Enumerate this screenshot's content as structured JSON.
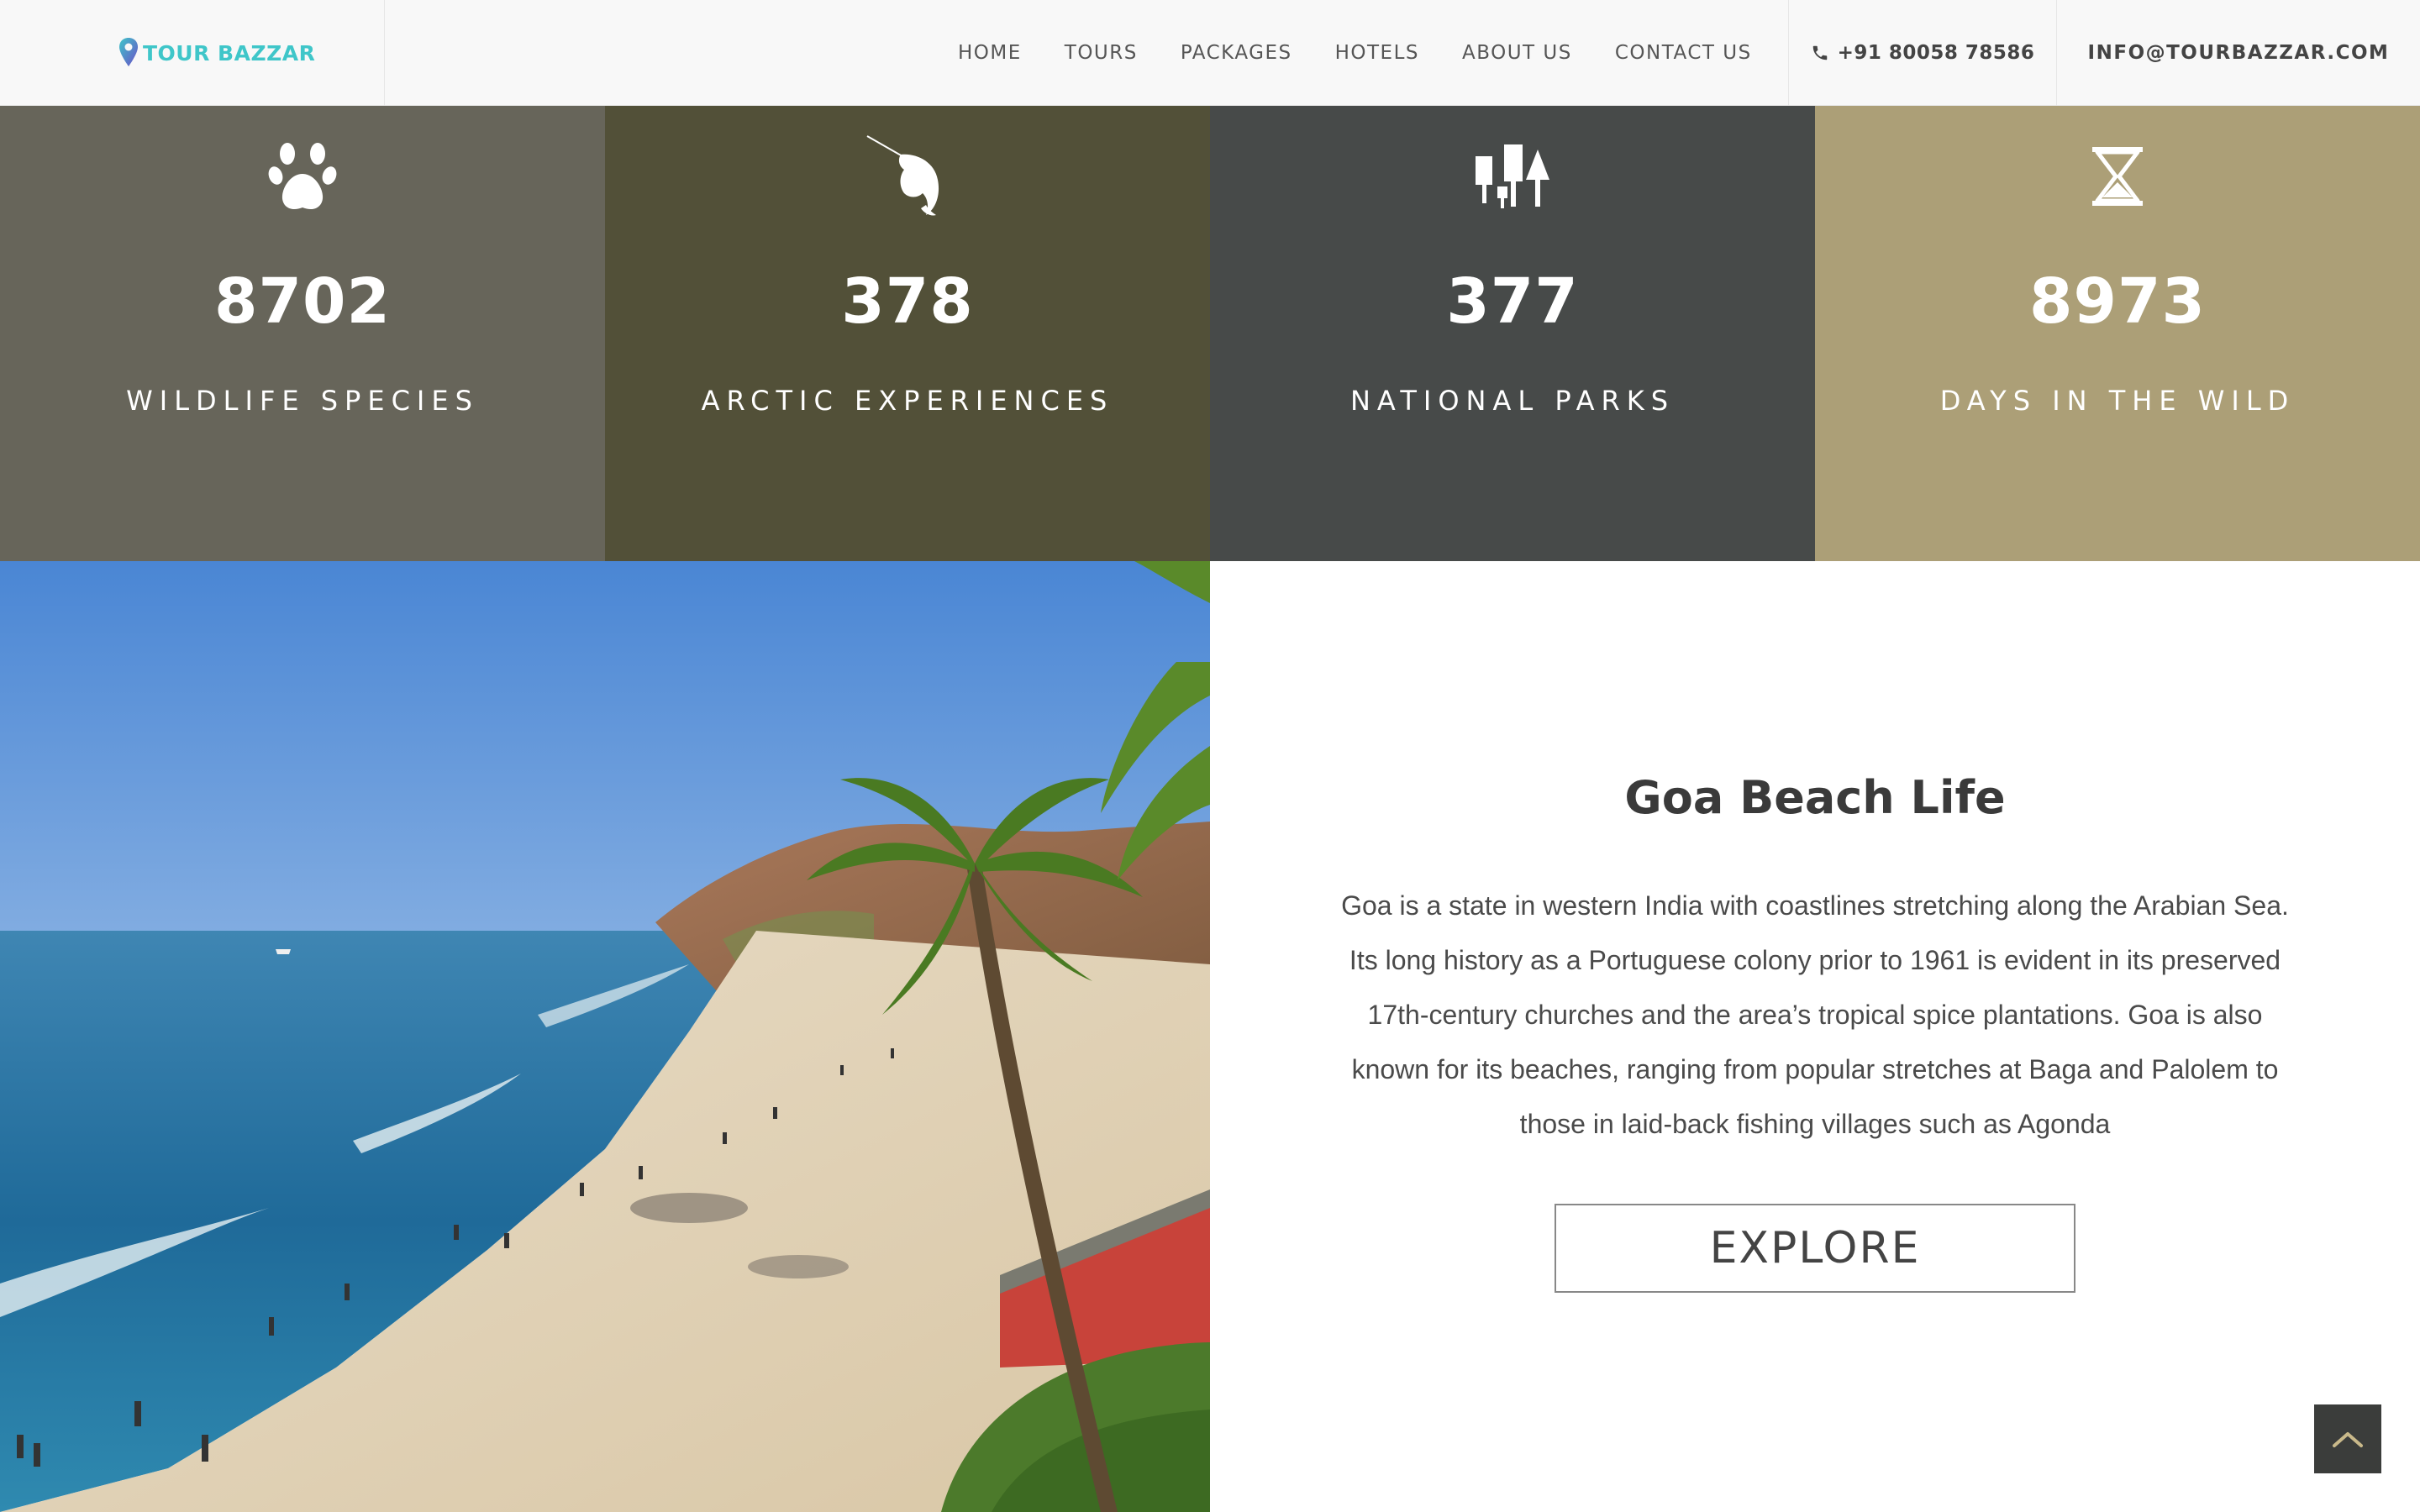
{
  "brand": {
    "name": "TOUR BAZZAR",
    "logo_icon": "map-pin-icon",
    "color": "#3fc6c9"
  },
  "nav": {
    "items": [
      {
        "label": "HOME"
      },
      {
        "label": "TOURS"
      },
      {
        "label": "PACKAGES"
      },
      {
        "label": "HOTELS"
      },
      {
        "label": "ABOUT US"
      },
      {
        "label": "CONTACT US"
      }
    ]
  },
  "contact": {
    "phone_icon": "phone-icon",
    "phone": "+91 80058 78586",
    "email": "INFO@TOURBAZZAR.COM"
  },
  "stats": [
    {
      "icon": "paw-icon",
      "value": "8702",
      "label": "WILDLIFE SPECIES",
      "bg": "#67655a"
    },
    {
      "icon": "narwhal-icon",
      "value": "378",
      "label": "ARCTIC EXPERIENCES",
      "bg": "#525038"
    },
    {
      "icon": "trees-icon",
      "value": "377",
      "label": "NATIONAL PARKS",
      "bg": "#474a49"
    },
    {
      "icon": "hourglass-icon",
      "value": "8973",
      "label": "DAYS IN THE WILD",
      "bg": "#ac9f77"
    }
  ],
  "feature": {
    "title": "Goa Beach Life",
    "description": "Goa is a state in western India with coastlines stretching along the Arabian Sea. Its long history as a Portuguese colony prior to 1961 is evident in its preserved 17th-century churches and the area’s tropical spice plantations. Goa is also known for its beaches, ranging from popular stretches at Baga and Palolem to those in laid-back fishing villages such as Agonda",
    "button_label": "EXPLORE"
  },
  "scroll_top_icon": "chevron-up-icon"
}
